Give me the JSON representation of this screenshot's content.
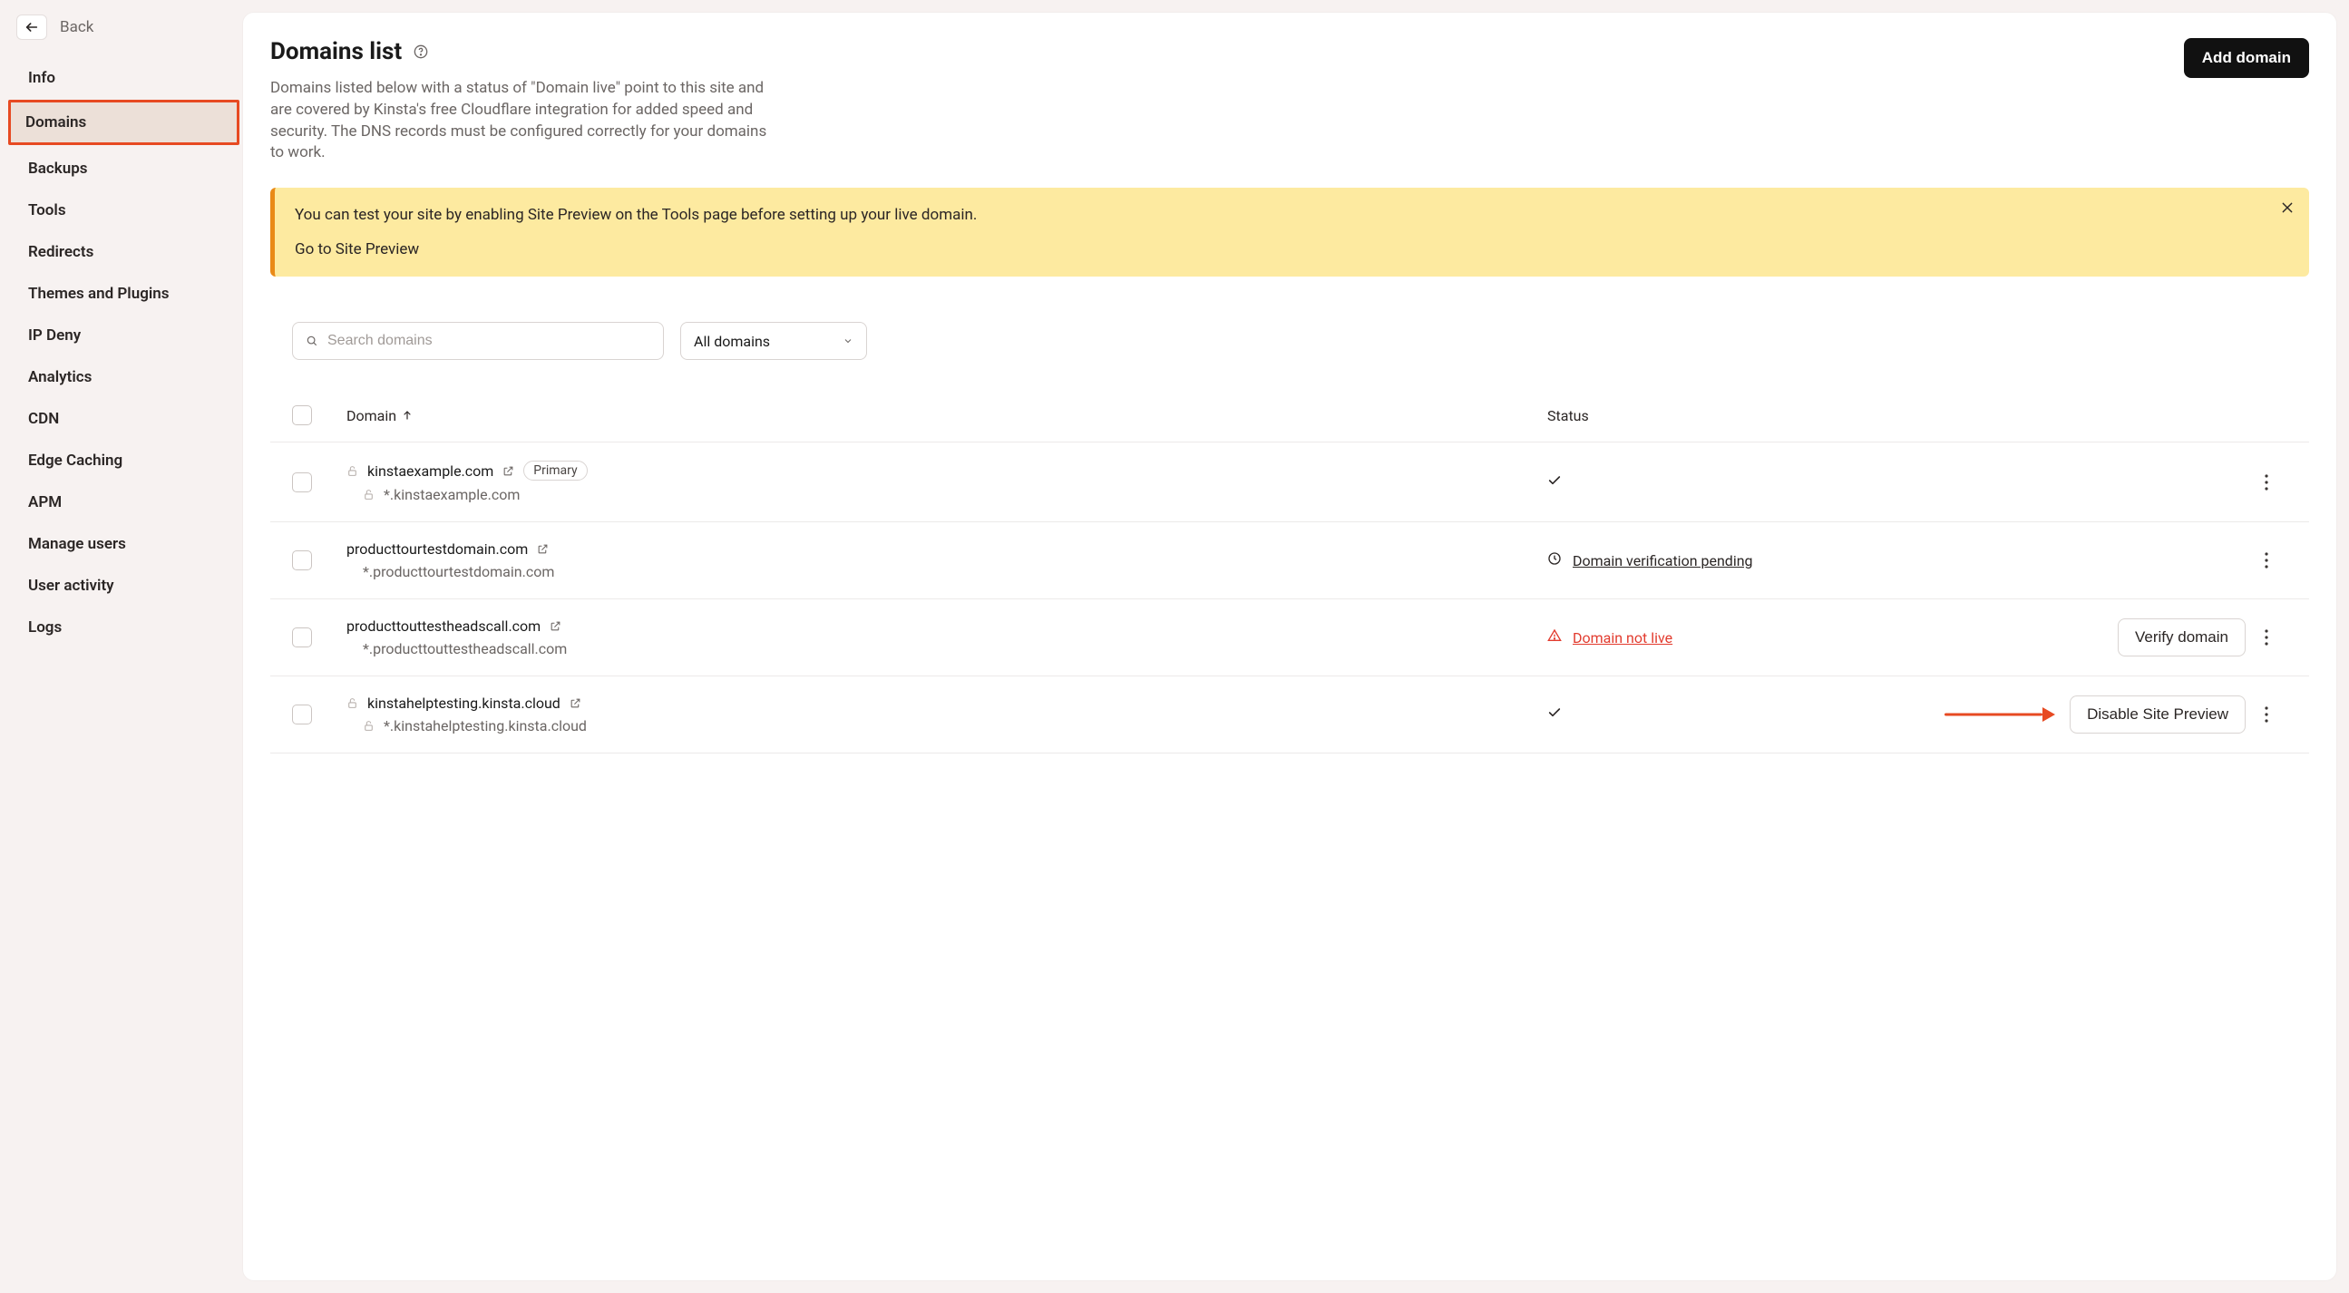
{
  "back_label": "Back",
  "sidebar": {
    "items": [
      {
        "label": "Info"
      },
      {
        "label": "Domains"
      },
      {
        "label": "Backups"
      },
      {
        "label": "Tools"
      },
      {
        "label": "Redirects"
      },
      {
        "label": "Themes and Plugins"
      },
      {
        "label": "IP Deny"
      },
      {
        "label": "Analytics"
      },
      {
        "label": "CDN"
      },
      {
        "label": "Edge Caching"
      },
      {
        "label": "APM"
      },
      {
        "label": "Manage users"
      },
      {
        "label": "User activity"
      },
      {
        "label": "Logs"
      }
    ],
    "active_index": 1
  },
  "header": {
    "title": "Domains list",
    "add_button": "Add domain",
    "description": "Domains listed below with a status of \"Domain live\" point to this site and are covered by Kinsta's free Cloudflare integration for added speed and security. The DNS records must be configured correctly for your domains to work."
  },
  "banner": {
    "text": "You can test your site by enabling Site Preview on the Tools page before setting up your live domain.",
    "link": "Go to Site Preview"
  },
  "filters": {
    "search_placeholder": "Search domains",
    "select_label": "All domains"
  },
  "table": {
    "columns": {
      "domain": "Domain",
      "status": "Status"
    },
    "rows": [
      {
        "domain": "kinstaexample.com",
        "has_lock": true,
        "has_link": true,
        "primary": true,
        "primary_label": "Primary",
        "sub": "*.kinstaexample.com",
        "sub_lock": true,
        "status_type": "check",
        "status_text": "",
        "actions": []
      },
      {
        "domain": "producttourtestdomain.com",
        "has_lock": false,
        "has_link": true,
        "primary": false,
        "sub": "*.producttourtestdomain.com",
        "sub_lock": false,
        "status_type": "pending",
        "status_text": "Domain verification pending",
        "actions": []
      },
      {
        "domain": "producttouttestheadscall.com",
        "has_lock": false,
        "has_link": true,
        "primary": false,
        "sub": "*.producttouttestheadscall.com",
        "sub_lock": false,
        "status_type": "notlive",
        "status_text": "Domain not live",
        "actions": [
          "Verify domain"
        ]
      },
      {
        "domain": "kinstahelptesting.kinsta.cloud",
        "has_lock": true,
        "has_link": true,
        "primary": false,
        "sub": "*.kinstahelptesting.kinsta.cloud",
        "sub_lock": true,
        "status_type": "check",
        "status_text": "",
        "actions": [
          "Disable Site Preview"
        ],
        "annotated_arrow": true
      }
    ]
  }
}
